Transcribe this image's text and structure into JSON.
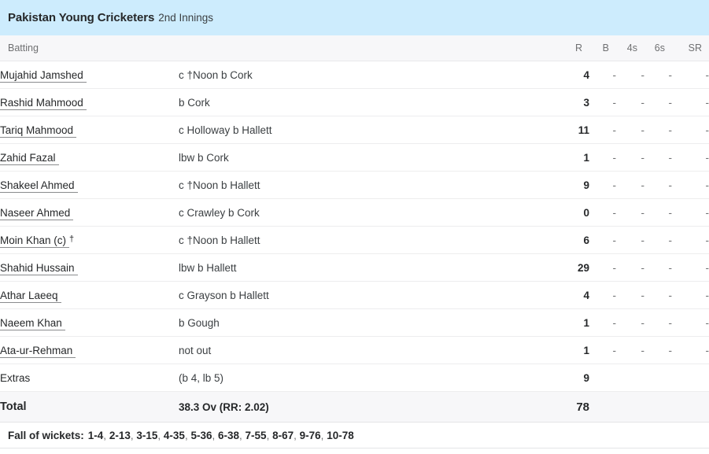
{
  "innings": {
    "team": "Pakistan Young Cricketers",
    "label": "2nd Innings"
  },
  "columns": {
    "batting": "Batting",
    "runs": "R",
    "balls": "B",
    "fours": "4s",
    "sixes": "6s",
    "strike_rate": "SR"
  },
  "batsmen": [
    {
      "name": "Mujahid Jamshed",
      "marker": "",
      "dismissal": "c †Noon b Cork",
      "R": "4",
      "B": "-",
      "4s": "-",
      "6s": "-",
      "SR": "-"
    },
    {
      "name": "Rashid Mahmood",
      "marker": "",
      "dismissal": "b Cork",
      "R": "3",
      "B": "-",
      "4s": "-",
      "6s": "-",
      "SR": "-"
    },
    {
      "name": "Tariq Mahmood",
      "marker": "",
      "dismissal": "c Holloway b Hallett",
      "R": "11",
      "B": "-",
      "4s": "-",
      "6s": "-",
      "SR": "-"
    },
    {
      "name": "Zahid Fazal",
      "marker": "",
      "dismissal": "lbw b Cork",
      "R": "1",
      "B": "-",
      "4s": "-",
      "6s": "-",
      "SR": "-"
    },
    {
      "name": "Shakeel Ahmed",
      "marker": "",
      "dismissal": "c †Noon b Hallett",
      "R": "9",
      "B": "-",
      "4s": "-",
      "6s": "-",
      "SR": "-"
    },
    {
      "name": "Naseer Ahmed",
      "marker": "",
      "dismissal": "c Crawley b Cork",
      "R": "0",
      "B": "-",
      "4s": "-",
      "6s": "-",
      "SR": "-"
    },
    {
      "name": "Moin Khan (c)",
      "marker": "†",
      "dismissal": "c †Noon b Hallett",
      "R": "6",
      "B": "-",
      "4s": "-",
      "6s": "-",
      "SR": "-"
    },
    {
      "name": "Shahid Hussain",
      "marker": "",
      "dismissal": "lbw b Hallett",
      "R": "29",
      "B": "-",
      "4s": "-",
      "6s": "-",
      "SR": "-"
    },
    {
      "name": "Athar Laeeq",
      "marker": "",
      "dismissal": "c Grayson b Hallett",
      "R": "4",
      "B": "-",
      "4s": "-",
      "6s": "-",
      "SR": "-"
    },
    {
      "name": "Naeem Khan",
      "marker": "",
      "dismissal": "b Gough",
      "R": "1",
      "B": "-",
      "4s": "-",
      "6s": "-",
      "SR": "-"
    },
    {
      "name": "Ata-ur-Rehman",
      "marker": "",
      "dismissal": "not out",
      "R": "1",
      "B": "-",
      "4s": "-",
      "6s": "-",
      "SR": "-"
    }
  ],
  "extras": {
    "label": "Extras",
    "detail": "(b 4, lb 5)",
    "runs": "9"
  },
  "total": {
    "label": "Total",
    "detail": "38.3 Ov (RR: 2.02)",
    "runs": "78"
  },
  "fall_of_wickets": {
    "label": "Fall of wickets:",
    "entries": [
      "1-4",
      "2-13",
      "3-15",
      "4-35",
      "5-36",
      "6-38",
      "7-55",
      "8-67",
      "9-76",
      "10-78"
    ]
  },
  "colors": {
    "header_band": "#cdecfd",
    "header_row": "#f7f7f9",
    "total_row": "#f7f7f9"
  }
}
